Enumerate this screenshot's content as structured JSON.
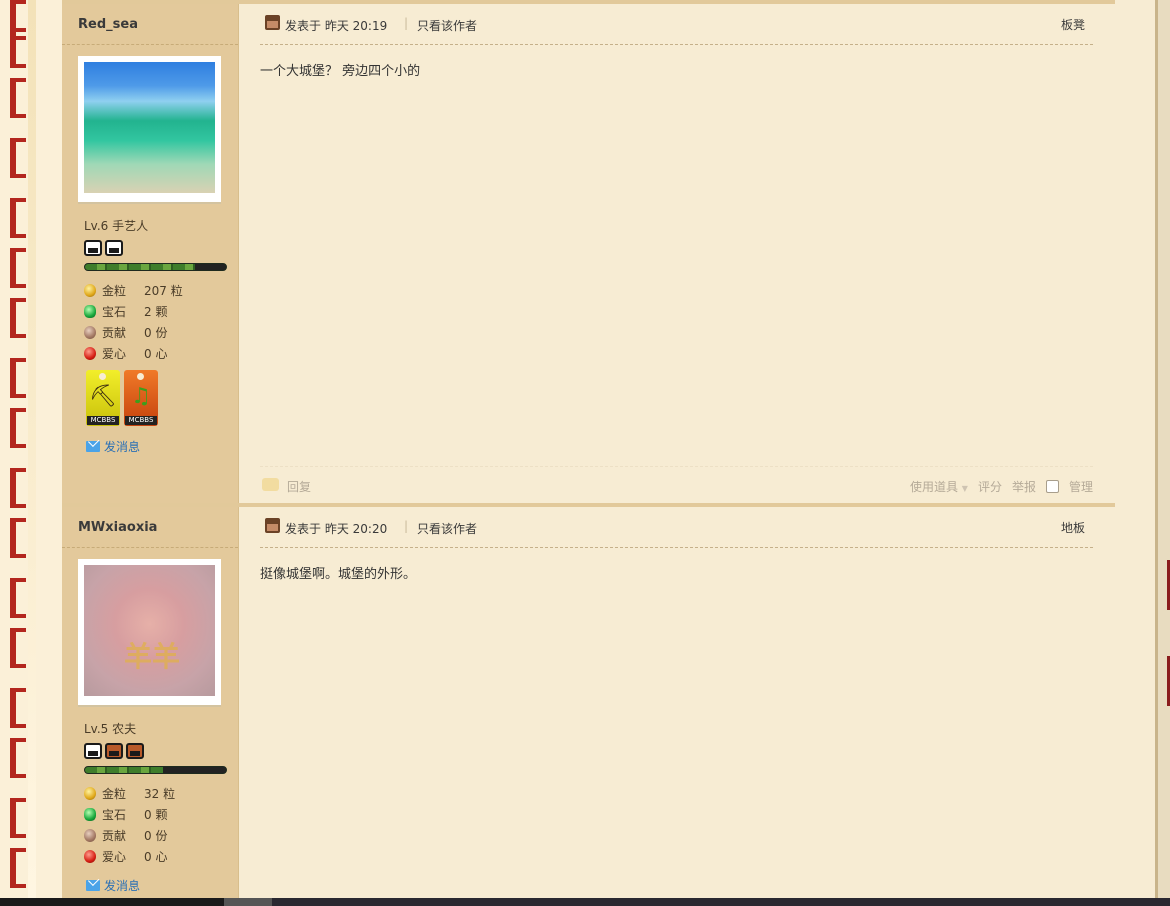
{
  "posts": [
    {
      "author": "Red_sea",
      "level_text": "Lv.6 手艺人",
      "exp_percent": 78,
      "rank_icons": [
        "rank-cart-icon",
        "rank-cart-icon"
      ],
      "stats": [
        {
          "icon": "gold-nugget-icon",
          "label": "金粒",
          "value": "207 粒"
        },
        {
          "icon": "gem-icon",
          "label": "宝石",
          "value": "2 颗"
        },
        {
          "icon": "contribution-icon",
          "label": "贡献",
          "value": "0 份"
        },
        {
          "icon": "heart-apple-icon",
          "label": "爱心",
          "value": "0 心"
        }
      ],
      "medals": [
        {
          "tag": "MCBBS",
          "glyph": "⛏"
        },
        {
          "tag": "MCBBS",
          "glyph": "♫"
        }
      ],
      "send_message": "发消息",
      "posted_at": "发表于 昨天 20:19",
      "only_author": "只看该作者",
      "floor": "板凳",
      "content": "一个大城堡？ 旁边四个小的",
      "footer": {
        "reply": "回复",
        "use_item": "使用道具",
        "rate": "评分",
        "report": "举报",
        "manage": "管理"
      }
    },
    {
      "author": "MWxiaoxia",
      "level_text": "Lv.5 农夫",
      "exp_percent": 55,
      "rank_icons": [
        "rank-cart-icon",
        "rank-cart-red-icon",
        "rank-cart-red-icon"
      ],
      "stats": [
        {
          "icon": "gold-nugget-icon",
          "label": "金粒",
          "value": "32 粒"
        },
        {
          "icon": "gem-icon",
          "label": "宝石",
          "value": "0 颗"
        },
        {
          "icon": "contribution-icon",
          "label": "贡献",
          "value": "0 份"
        },
        {
          "icon": "heart-apple-icon",
          "label": "爱心",
          "value": "0 心"
        }
      ],
      "avatar_stamp": "羊羊",
      "send_message": "发消息",
      "posted_at": "发表于 昨天 20:20",
      "only_author": "只看该作者",
      "floor": "地板",
      "content": "挺像城堡啊。城堡的外形。"
    }
  ]
}
